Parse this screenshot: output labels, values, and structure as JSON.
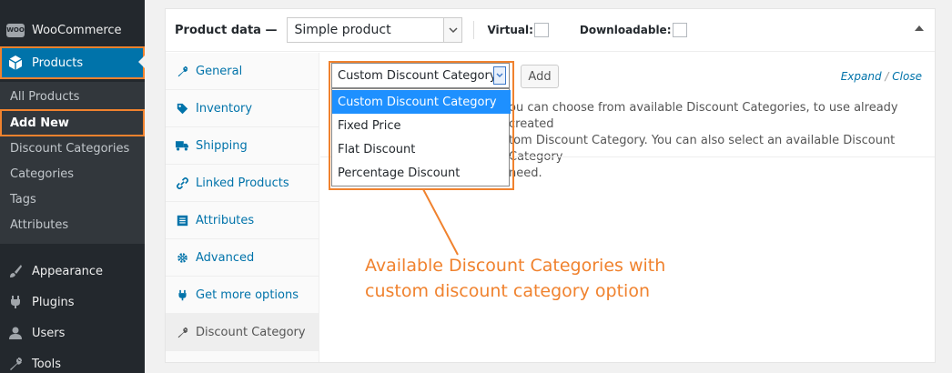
{
  "sidebar": {
    "woocommerce": {
      "label": "WooCommerce",
      "icon": "woocommerce-icon",
      "badge": "WOO"
    },
    "products": {
      "label": "Products",
      "icon": "products-box-icon"
    },
    "submenu": [
      {
        "label": "All Products"
      },
      {
        "label": "Add New"
      },
      {
        "label": "Discount Categories"
      },
      {
        "label": "Categories"
      },
      {
        "label": "Tags"
      },
      {
        "label": "Attributes"
      }
    ],
    "bottom": [
      {
        "label": "Appearance",
        "icon": "paintbrush-icon"
      },
      {
        "label": "Plugins",
        "icon": "plugin-icon"
      },
      {
        "label": "Users",
        "icon": "user-icon"
      },
      {
        "label": "Tools",
        "icon": "wrench-icon"
      }
    ]
  },
  "product_data": {
    "label": "Product data —",
    "type_select": "Simple product",
    "virtual_label": "Virtual:",
    "downloadable_label": "Downloadable:"
  },
  "tabs": [
    {
      "label": "General",
      "icon": "wrench-icon"
    },
    {
      "label": "Inventory",
      "icon": "tag-icon"
    },
    {
      "label": "Shipping",
      "icon": "truck-icon"
    },
    {
      "label": "Linked Products",
      "icon": "link-icon"
    },
    {
      "label": "Attributes",
      "icon": "list-icon"
    },
    {
      "label": "Advanced",
      "icon": "gear-icon"
    },
    {
      "label": "Get more options",
      "icon": "plugin-icon"
    },
    {
      "label": "Discount Category",
      "icon": "wrench-icon"
    }
  ],
  "discount": {
    "select_value": "Custom Discount Category",
    "add_label": "Add",
    "expand_label": "Expand",
    "slash": "/",
    "close_label": "Close",
    "desc_lines": [
      "ou can choose from available Discount Categories, to use already created",
      "tom Discount Category. You can also select an available Discount Category",
      "need."
    ],
    "options": [
      {
        "label": "Custom Discount Category",
        "selected": true
      },
      {
        "label": "Fixed Price",
        "selected": false
      },
      {
        "label": "Flat Discount",
        "selected": false
      },
      {
        "label": "Percentage Discount",
        "selected": false
      }
    ]
  },
  "callout": {
    "line1": "Available Discount Categories with",
    "line2": "custom discount category option",
    "color": "#f0822e"
  },
  "colors": {
    "accent": "#0073aa",
    "highlight": "#f0822e",
    "selected": "#1e90ff"
  }
}
